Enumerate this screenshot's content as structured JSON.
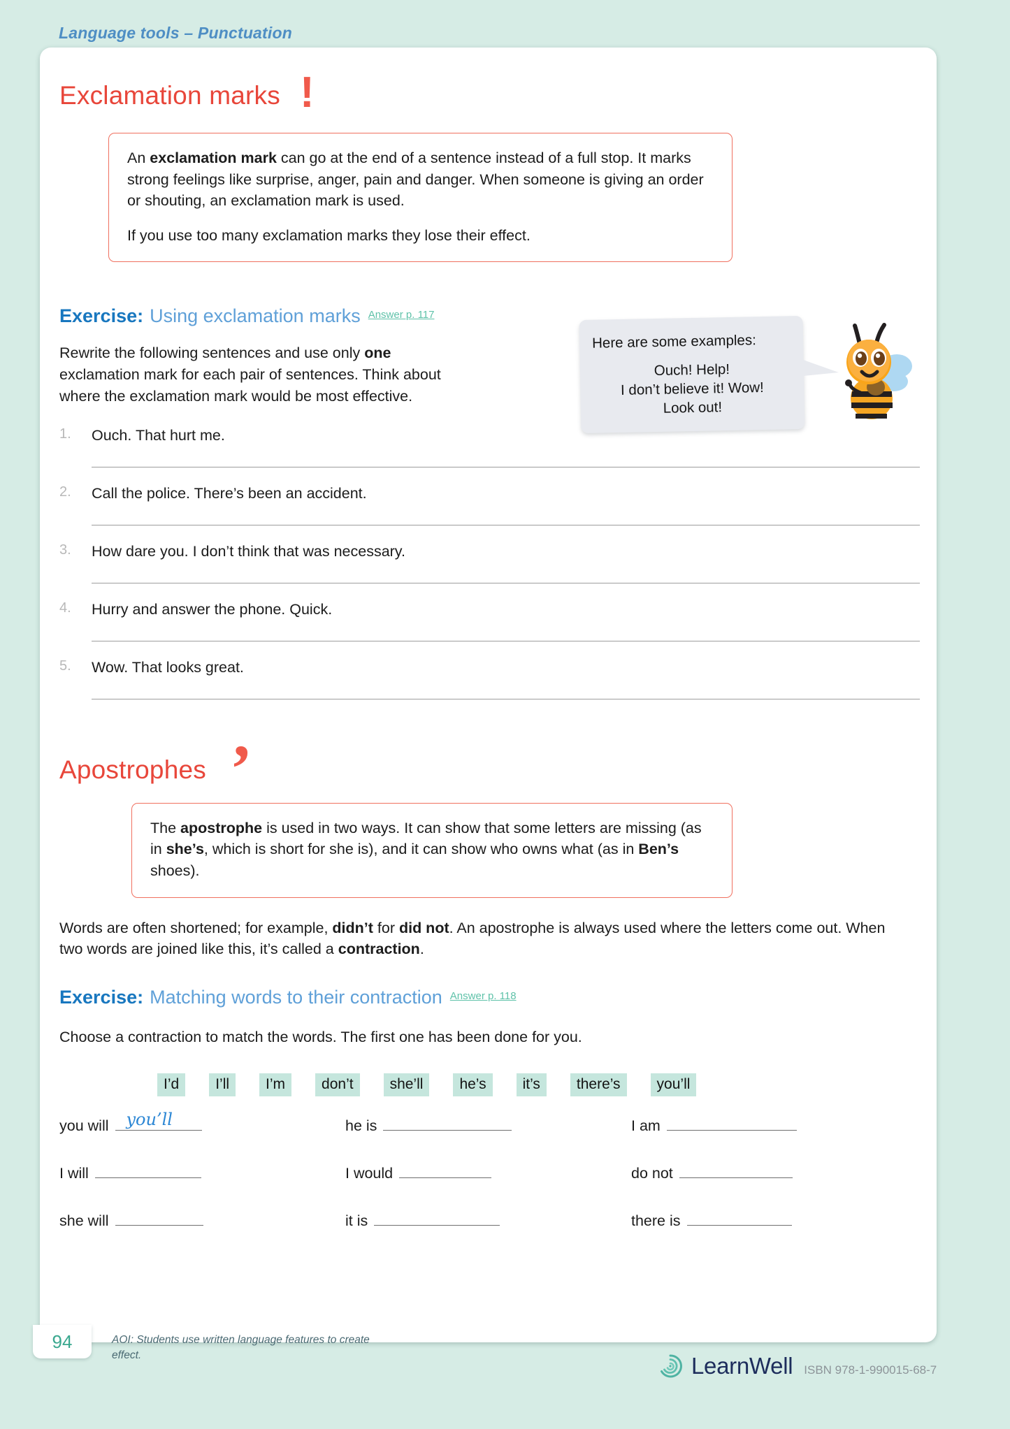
{
  "running_head": "Language tools – Punctuation",
  "colors": {
    "page_bg": "#d6ece5",
    "accent_red": "#e8463a",
    "accent_blue": "#1877bf",
    "accent_teal": "#3aa88f",
    "chip_bg": "#c5e6dd"
  },
  "sections": [
    {
      "title": "Exclamation marks",
      "glyph": "!",
      "definition": [
        {
          "parts": [
            {
              "t": "An ",
              "b": false
            },
            {
              "t": "exclamation mark",
              "b": true
            },
            {
              "t": " can go at the end of a sentence instead of a full stop. It marks strong feelings like surprise, anger, pain and danger. When someone is giving an order or shouting, an exclamation mark is used.",
              "b": false
            }
          ]
        },
        {
          "parts": [
            {
              "t": "If you use too many exclamation marks they lose their effect.",
              "b": false
            }
          ]
        }
      ],
      "exercise": {
        "label": "Exercise:",
        "title": "Using exclamation marks",
        "answer_ref": "Answer p. 117",
        "instruction_parts": [
          {
            "t": "Rewrite the following sentences and use only ",
            "b": false
          },
          {
            "t": "one",
            "b": true
          },
          {
            "t": " exclamation mark for each pair of sentences. Think about where the exclamation mark would be most effective.",
            "b": false
          }
        ],
        "questions": [
          {
            "num": "1.",
            "text": "Ouch. That hurt me."
          },
          {
            "num": "2.",
            "text": "Call the police. There’s been an accident."
          },
          {
            "num": "3.",
            "text": "How dare you. I don’t think that was necessary."
          },
          {
            "num": "4.",
            "text": "Hurry and answer the phone. Quick."
          },
          {
            "num": "5.",
            "text": "Wow. That looks great."
          }
        ]
      }
    },
    {
      "title": "Apostrophes",
      "glyph": "’",
      "definition": [
        {
          "parts": [
            {
              "t": "The ",
              "b": false
            },
            {
              "t": "apostrophe",
              "b": true
            },
            {
              "t": " is used in two ways. It can show that some letters are missing (as in ",
              "b": false
            },
            {
              "t": "she’s",
              "b": true
            },
            {
              "t": ", which is short for she is), and it can show who owns what (as in ",
              "b": false
            },
            {
              "t": "Ben’s",
              "b": true
            },
            {
              "t": " shoes).",
              "b": false
            }
          ]
        }
      ],
      "paragraph_parts": [
        {
          "t": "Words are often shortened; for example, ",
          "b": false
        },
        {
          "t": "didn’t",
          "b": true
        },
        {
          "t": " for ",
          "b": false
        },
        {
          "t": "did not",
          "b": true
        },
        {
          "t": ". An apostrophe is always used where the letters come out. When  two words are joined like this, it’s called a ",
          "b": false
        },
        {
          "t": "contraction",
          "b": true
        },
        {
          "t": ".",
          "b": false
        }
      ],
      "exercise": {
        "label": "Exercise:",
        "title": "Matching words to their contraction",
        "answer_ref": "Answer p. 118",
        "instruction_parts": [
          {
            "t": "Choose a contraction to match the words. The first one has been done for you.",
            "b": false
          }
        ],
        "chips": [
          "I’d",
          "I’ll",
          "I’m",
          "don’t",
          "she’ll",
          "he’s",
          "it’s",
          "there’s",
          "you’ll"
        ],
        "match_columns": [
          [
            {
              "label": "you will",
              "answer": "you’ll",
              "line_width": 124
            },
            {
              "label": "I will",
              "answer": "",
              "line_width": 152
            },
            {
              "label": "she will",
              "answer": "",
              "line_width": 126
            }
          ],
          [
            {
              "label": "he is",
              "answer": "",
              "line_width": 184
            },
            {
              "label": "I would",
              "answer": "",
              "line_width": 132
            },
            {
              "label": "it is",
              "answer": "",
              "line_width": 180
            }
          ],
          [
            {
              "label": "I am",
              "answer": "",
              "line_width": 186
            },
            {
              "label": "do not",
              "answer": "",
              "line_width": 162
            },
            {
              "label": "there is",
              "answer": "",
              "line_width": 150
            }
          ]
        ]
      }
    }
  ],
  "bubble": {
    "lead": "Here are some examples:",
    "examples_line1": "Ouch!   Help!",
    "examples_line2": "I don’t believe it!   Wow!",
    "examples_line3": "Look out!"
  },
  "footer": {
    "page_number": "94",
    "aoi": "AOI: Students use written language features to create effect.",
    "brand": "LearnWell",
    "isbn": "ISBN 978-1-990015-68-7"
  }
}
